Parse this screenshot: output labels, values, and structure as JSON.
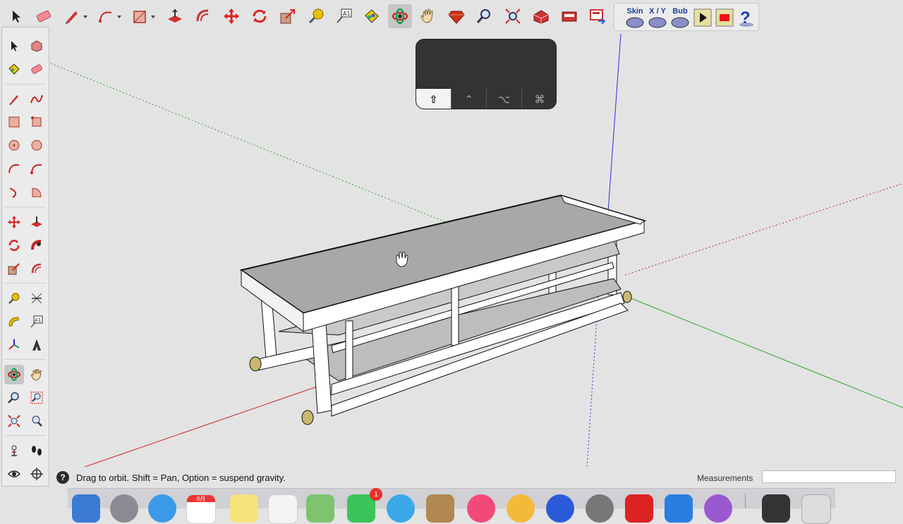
{
  "toolbar": {
    "tools": [
      {
        "name": "select-tool",
        "icon": "arrow-cursor-icon"
      },
      {
        "name": "eraser-tool",
        "icon": "eraser-icon"
      },
      {
        "name": "line-tool",
        "icon": "pencil-icon"
      },
      {
        "name": "arc-tool",
        "icon": "arc-icon"
      },
      {
        "name": "shapes-tool",
        "icon": "rectangle-icon"
      },
      {
        "name": "push-pull-tool",
        "icon": "push-pull-icon"
      },
      {
        "name": "offset-tool",
        "icon": "offset-icon"
      },
      {
        "name": "move-tool",
        "icon": "move-arrows-icon"
      },
      {
        "name": "rotate-tool",
        "icon": "rotate-icon"
      },
      {
        "name": "scale-tool",
        "icon": "scale-icon"
      },
      {
        "name": "tape-measure-tool",
        "icon": "tape-measure-icon"
      },
      {
        "name": "text-tool",
        "icon": "text-label-icon"
      },
      {
        "name": "paint-bucket-tool",
        "icon": "paint-bucket-icon"
      },
      {
        "name": "orbit-tool",
        "icon": "orbit-icon"
      },
      {
        "name": "pan-tool",
        "icon": "hand-icon"
      },
      {
        "name": "ruby-console-tool",
        "icon": "ruby-gem-icon"
      },
      {
        "name": "zoom-tool",
        "icon": "magnifier-icon"
      },
      {
        "name": "zoom-extents-tool",
        "icon": "zoom-extents-icon"
      },
      {
        "name": "warehouse-tool",
        "icon": "3d-warehouse-icon"
      },
      {
        "name": "extension-warehouse-tool",
        "icon": "extension-warehouse-icon"
      },
      {
        "name": "layout-tool",
        "icon": "send-to-layout-icon"
      }
    ],
    "active_tool": "orbit-tool"
  },
  "plugin_bar": {
    "buttons": [
      {
        "label": "Skin"
      },
      {
        "label": "X / Y"
      },
      {
        "label": "Bub"
      },
      {
        "label": ""
      },
      {
        "label": ""
      },
      {
        "label": ""
      }
    ]
  },
  "modifier_panel": {
    "keys": [
      "⇧",
      "⌃",
      "⌥",
      "⌘"
    ],
    "active_key": "⇧"
  },
  "status": {
    "help_glyph": "?",
    "text": "Drag to orbit. Shift = Pan, Option = suspend gravity.",
    "measurements_label": "Measurements",
    "measurements_value": ""
  },
  "dock": {
    "badge_count": "1",
    "calendar_label": "8月"
  },
  "colors": {
    "background": "#e3e3e3",
    "axis_red": "#c8282a",
    "axis_green": "#2ea52e",
    "axis_blue": "#2b2be0",
    "model_top": "#a8a8a8",
    "model_edge": "#111111",
    "cap_yellow": "#c9b870"
  }
}
